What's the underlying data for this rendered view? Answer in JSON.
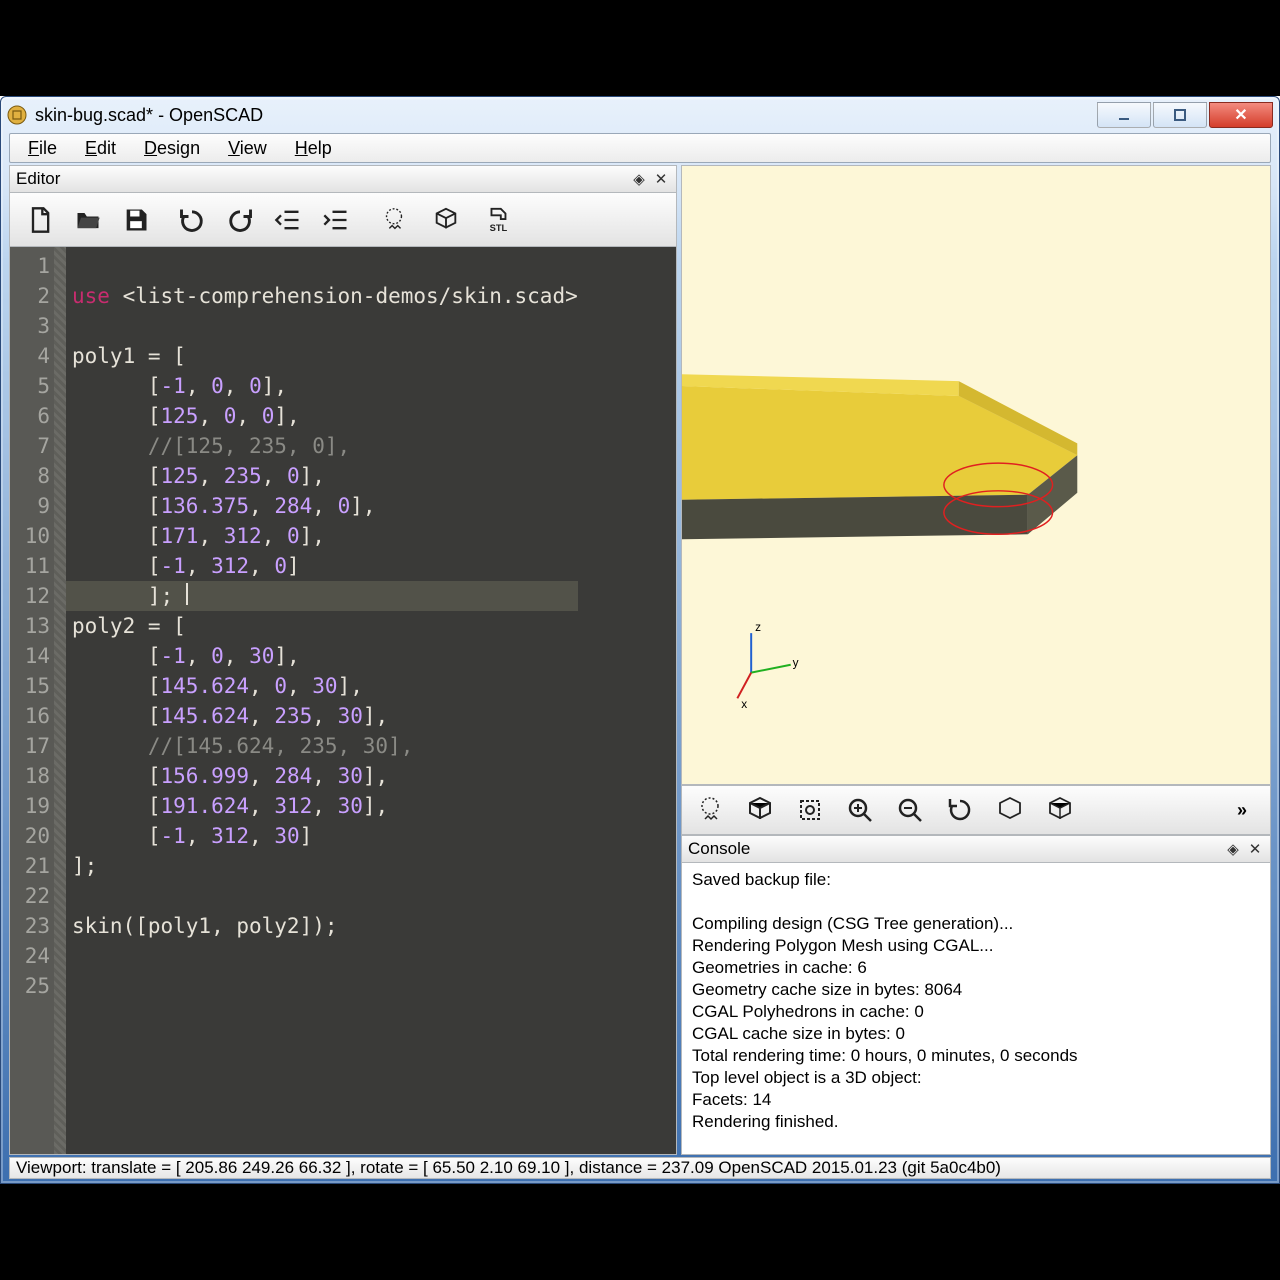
{
  "window": {
    "title": "skin-bug.scad* - OpenSCAD"
  },
  "menu": {
    "file": "File",
    "edit": "Edit",
    "design": "Design",
    "view": "View",
    "help": "Help"
  },
  "editor": {
    "panel_title": "Editor",
    "lines": [
      {
        "n": 1,
        "html": ""
      },
      {
        "n": 2,
        "html": "<span class='kw'>use</span> &lt;list-comprehension-demos/skin.scad&gt;"
      },
      {
        "n": 3,
        "html": ""
      },
      {
        "n": 4,
        "html": "poly1 = ["
      },
      {
        "n": 5,
        "html": "      [<span class='num'>-1</span>, <span class='num'>0</span>, <span class='num'>0</span>],"
      },
      {
        "n": 6,
        "html": "      [<span class='num'>125</span>, <span class='num'>0</span>, <span class='num'>0</span>],"
      },
      {
        "n": 7,
        "html": "      <span class='com'>//[125, 235, 0],</span>"
      },
      {
        "n": 8,
        "html": "      [<span class='num'>125</span>, <span class='num'>235</span>, <span class='num'>0</span>],"
      },
      {
        "n": 9,
        "html": "      [<span class='num'>136.375</span>, <span class='num'>284</span>, <span class='num'>0</span>],"
      },
      {
        "n": 10,
        "html": "      [<span class='num'>171</span>, <span class='num'>312</span>, <span class='num'>0</span>],"
      },
      {
        "n": 11,
        "html": "      [<span class='num'>-1</span>, <span class='num'>312</span>, <span class='num'>0</span>]"
      },
      {
        "n": 12,
        "html": "      ]; <span class='cursor'></span>",
        "hl": true
      },
      {
        "n": 13,
        "html": "poly2 = ["
      },
      {
        "n": 14,
        "html": "      [<span class='num'>-1</span>, <span class='num'>0</span>, <span class='num'>30</span>],"
      },
      {
        "n": 15,
        "html": "      [<span class='num'>145.624</span>, <span class='num'>0</span>, <span class='num'>30</span>],"
      },
      {
        "n": 16,
        "html": "      [<span class='num'>145.624</span>, <span class='num'>235</span>, <span class='num'>30</span>],"
      },
      {
        "n": 17,
        "html": "      <span class='com'>//[145.624, 235, 30],</span>"
      },
      {
        "n": 18,
        "html": "      [<span class='num'>156.999</span>, <span class='num'>284</span>, <span class='num'>30</span>],"
      },
      {
        "n": 19,
        "html": "      [<span class='num'>191.624</span>, <span class='num'>312</span>, <span class='num'>30</span>],"
      },
      {
        "n": 20,
        "html": "      [<span class='num'>-1</span>, <span class='num'>312</span>, <span class='num'>30</span>]"
      },
      {
        "n": 21,
        "html": "];"
      },
      {
        "n": 22,
        "html": ""
      },
      {
        "n": 23,
        "html": "skin([poly1, poly2]);"
      },
      {
        "n": 24,
        "html": ""
      },
      {
        "n": 25,
        "html": ""
      }
    ]
  },
  "console": {
    "panel_title": "Console",
    "lines": [
      "Saved backup file:",
      "",
      "Compiling design (CSG Tree generation)...",
      "Rendering Polygon Mesh using CGAL...",
      "Geometries in cache: 6",
      "Geometry cache size in bytes: 8064",
      "CGAL Polyhedrons in cache: 0",
      "CGAL cache size in bytes: 0",
      "Total rendering time: 0 hours, 0 minutes, 0 seconds",
      "   Top level object is a 3D object:",
      "   Facets:         14",
      "Rendering finished."
    ]
  },
  "status": "Viewport: translate = [ 205.86 249.26 66.32 ], rotate = [ 65.50 2.10 69.10 ], distance = 237.09  OpenSCAD 2015.01.23 (git 5a0c4b0)"
}
